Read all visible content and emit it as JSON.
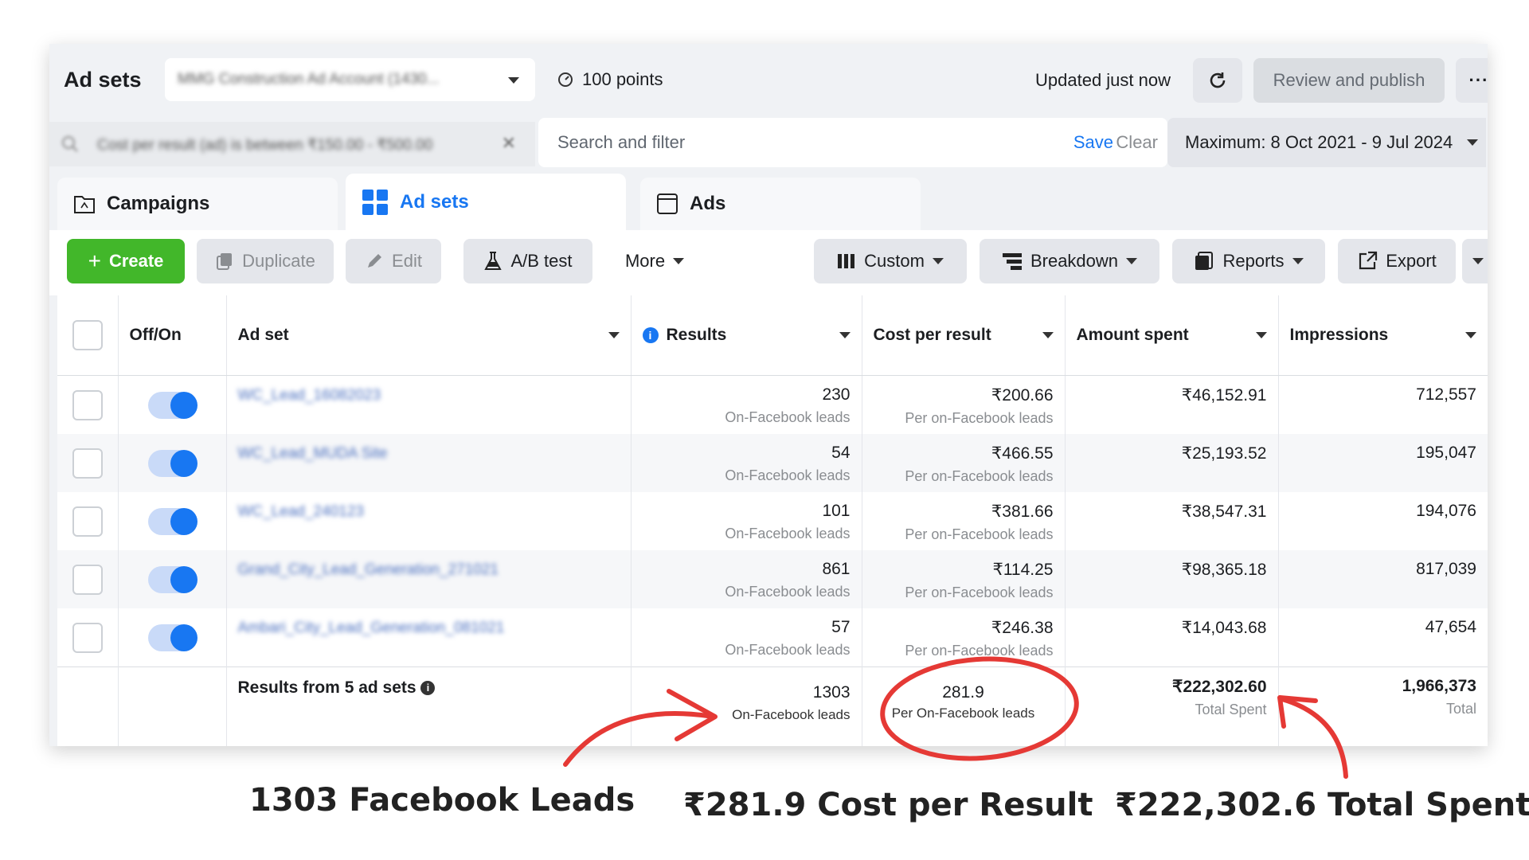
{
  "header": {
    "title": "Ad sets",
    "account_selector": "MMG Construction Ad Account (1430...",
    "points": "100 points",
    "updated": "Updated just now",
    "review_label": "Review and publish",
    "more": "···"
  },
  "filter": {
    "chip": "Cost per result (ad) is between ₹150.00 - ₹500.00",
    "placeholder": "Search and filter",
    "save": "Save",
    "clear": "Clear",
    "date_range": "Maximum: 8 Oct 2021 - 9 Jul 2024"
  },
  "tabs": [
    {
      "label": "Campaigns"
    },
    {
      "label": "Ad sets"
    },
    {
      "label": "Ads"
    }
  ],
  "toolbar": {
    "create": "Create",
    "duplicate": "Duplicate",
    "edit": "Edit",
    "ab_test": "A/B test",
    "more": "More",
    "custom": "Custom",
    "breakdown": "Breakdown",
    "reports": "Reports",
    "export": "Export"
  },
  "columns": {
    "off_on": "Off/On",
    "ad_set": "Ad set",
    "results": "Results",
    "cost_per_result": "Cost per result",
    "amount_spent": "Amount spent",
    "impressions": "Impressions"
  },
  "rows": [
    {
      "name": "WC_Lead_16082023",
      "results": "230",
      "results_sub": "On-Facebook leads",
      "cpr": "₹200.66",
      "cpr_sub": "Per on-Facebook leads",
      "spent": "₹46,152.91",
      "impressions": "712,557"
    },
    {
      "name": "WC_Lead_MUDA Site",
      "results": "54",
      "results_sub": "On-Facebook leads",
      "cpr": "₹466.55",
      "cpr_sub": "Per on-Facebook leads",
      "spent": "₹25,193.52",
      "impressions": "195,047"
    },
    {
      "name": "WC_Lead_240123",
      "results": "101",
      "results_sub": "On-Facebook leads",
      "cpr": "₹381.66",
      "cpr_sub": "Per on-Facebook leads",
      "spent": "₹38,547.31",
      "impressions": "194,076"
    },
    {
      "name": "Grand_City_Lead_Generation_271021",
      "results": "861",
      "results_sub": "On-Facebook leads",
      "cpr": "₹114.25",
      "cpr_sub": "Per on-Facebook leads",
      "spent": "₹98,365.18",
      "impressions": "817,039"
    },
    {
      "name": "Ambari_City_Lead_Generation_081021",
      "results": "57",
      "results_sub": "On-Facebook leads",
      "cpr": "₹246.38",
      "cpr_sub": "Per on-Facebook leads",
      "spent": "₹14,043.68",
      "impressions": "47,654"
    }
  ],
  "totals": {
    "label": "Results from 5 ad sets",
    "results": "1303",
    "results_sub": "On-Facebook leads",
    "cpr": "281.9",
    "cpr_sub": "Per On-Facebook leads",
    "spent": "₹222,302.60",
    "spent_sub": "Total Spent",
    "impressions": "1,966,373",
    "impressions_sub": "Total"
  },
  "annotations": {
    "leads": "1303 Facebook Leads",
    "cpr": "₹281.9 Cost per Result",
    "spent": "₹222,302.6 Total Spent",
    "color": "#e53935"
  }
}
